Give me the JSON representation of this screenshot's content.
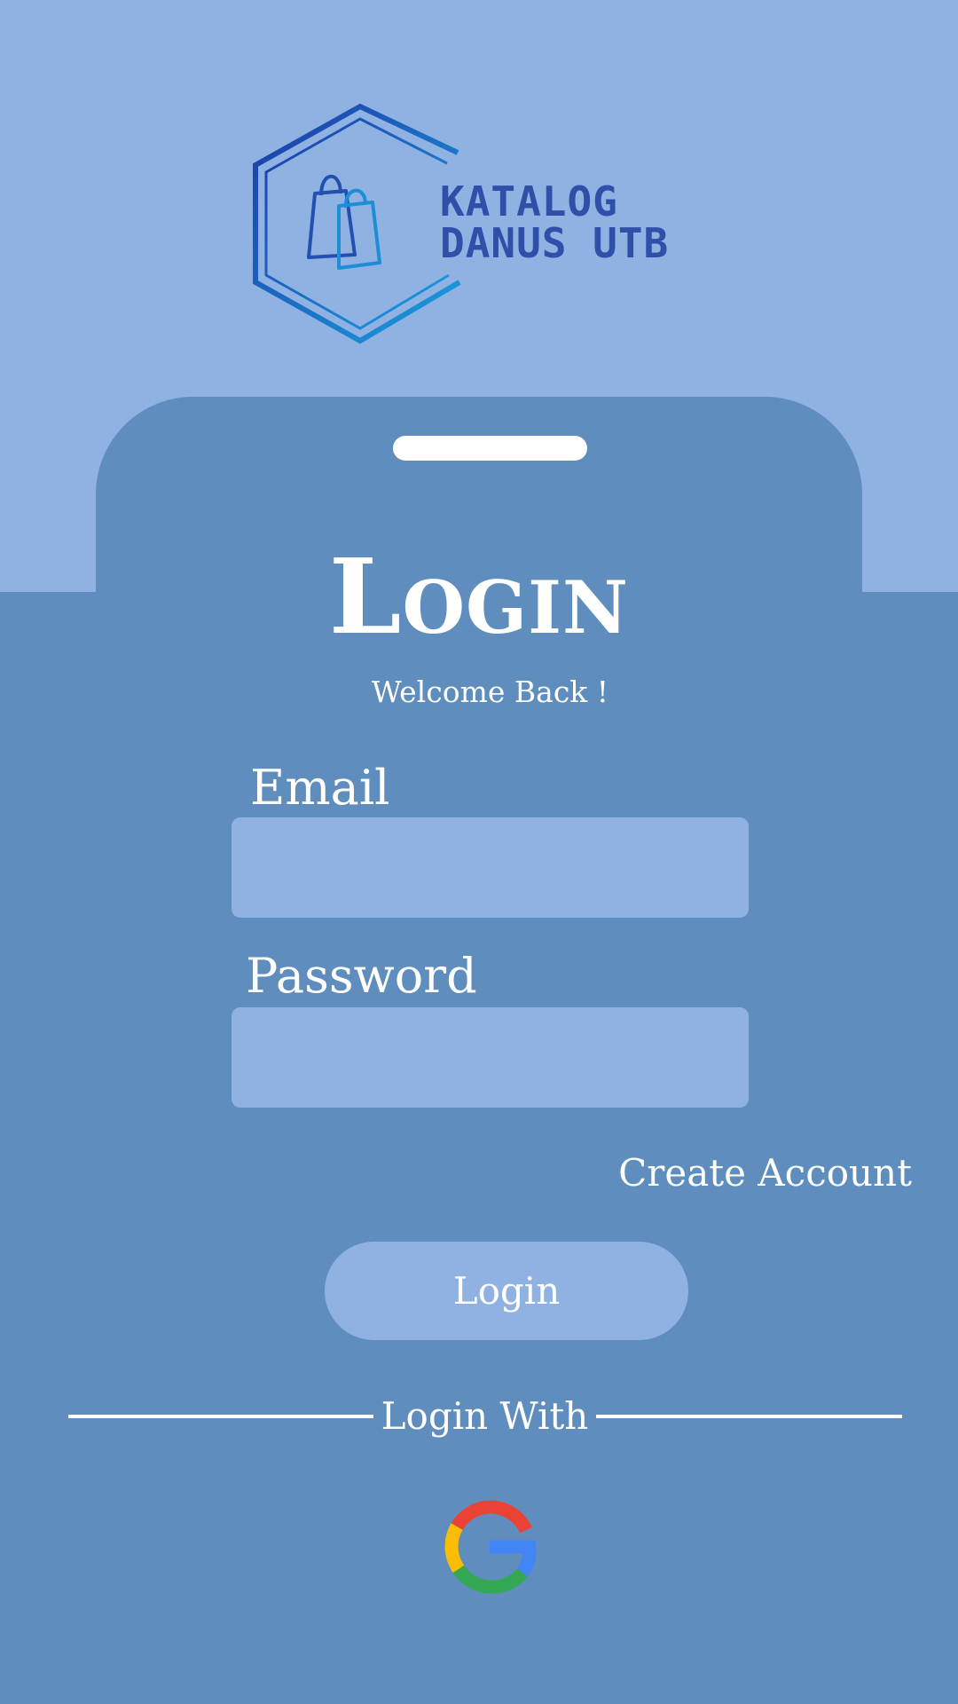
{
  "app": {
    "logo_text_line1": "KATALOG",
    "logo_text_line2": "DANUS UTB"
  },
  "login": {
    "title": "Login",
    "subtitle": "Welcome Back !",
    "email_label": "Email",
    "email_value": "",
    "password_label": "Password",
    "password_value": "",
    "create_account_label": "Create Account",
    "login_button_label": "Login",
    "login_with_label": "Login With"
  },
  "icons": {
    "logo": "shopping-bags-hexagon-icon",
    "google": "google-icon"
  },
  "colors": {
    "top_background": "#8fb2e3",
    "card_background": "#5f8ebe",
    "input_background": "#8fb2e3",
    "text": "#ffffff",
    "logo_text": "#2f4fa8"
  }
}
